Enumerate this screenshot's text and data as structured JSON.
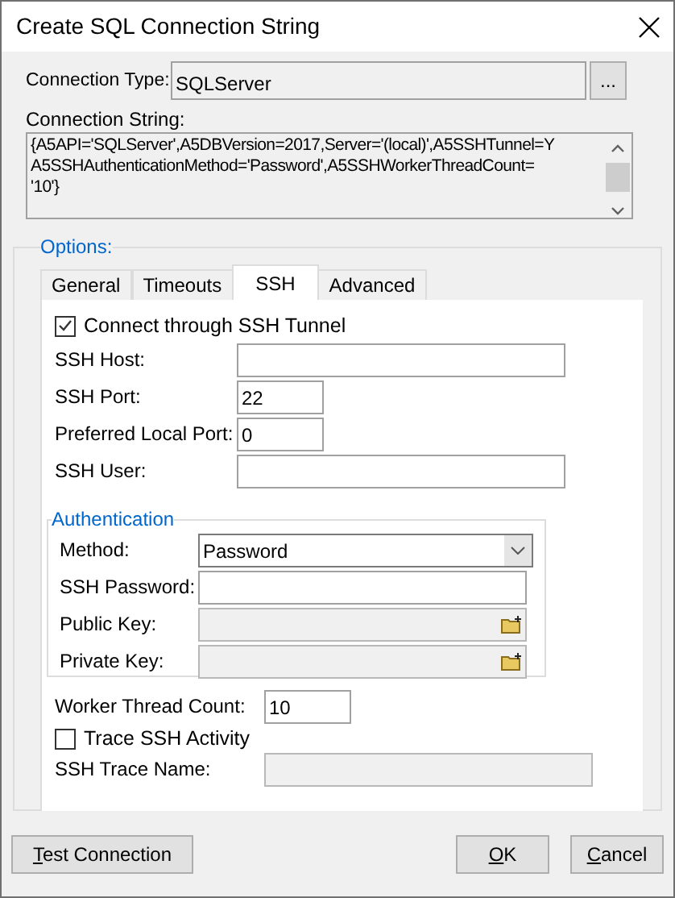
{
  "window": {
    "title": "Create SQL Connection String"
  },
  "connection_type": {
    "label": "Connection Type:",
    "value": "SQLServer",
    "browse_label": "..."
  },
  "connection_string": {
    "label": "Connection String:",
    "lines": [
      "{A5API='SQLServer',A5DBVersion=2017,Server='(local)',A5SSHTunnel=Y",
      "A5SSHAuthenticationMethod='Password',A5SSHWorkerThreadCount=",
      "'10'}"
    ]
  },
  "options": {
    "legend": "Options:",
    "tabs": [
      {
        "label": "General",
        "selected": false
      },
      {
        "label": "Timeouts",
        "selected": false
      },
      {
        "label": "SSH",
        "selected": true
      },
      {
        "label": "Advanced",
        "selected": false
      }
    ],
    "tunnel": {
      "label": "Connect through SSH Tunnel",
      "checked": true
    },
    "fields": [
      {
        "label": "SSH Host:",
        "kind": "text"
      },
      {
        "label": "SSH Port:",
        "kind": "number",
        "value": "22"
      },
      {
        "label": "Preferred Local Port:",
        "kind": "number",
        "value": "0"
      },
      {
        "label": "SSH User:",
        "kind": "text"
      }
    ],
    "authentication": {
      "legend": "Authentication",
      "method": {
        "label": "Method:",
        "value": "Password"
      },
      "fields": [
        {
          "label": "SSH Password:",
          "kind": "text",
          "disabled": false
        },
        {
          "label": "Public Key:",
          "kind": "file",
          "disabled": true
        },
        {
          "label": "Private Key:",
          "kind": "file",
          "disabled": true
        }
      ]
    },
    "worker_thread_count": {
      "label": "Worker Thread Count:",
      "value": "10"
    },
    "trace": {
      "label": "Trace SSH Activity",
      "checked": false
    },
    "trace_name": {
      "label": "SSH Trace Name:",
      "disabled": true
    }
  },
  "buttons": [
    {
      "label": "Test Connection",
      "first_letter_underlined": true,
      "kind": "left"
    },
    {
      "label": "OK",
      "first_letter_underlined": true,
      "kind": "right"
    },
    {
      "label": "Cancel",
      "first_letter_underlined": true,
      "kind": "right"
    }
  ]
}
